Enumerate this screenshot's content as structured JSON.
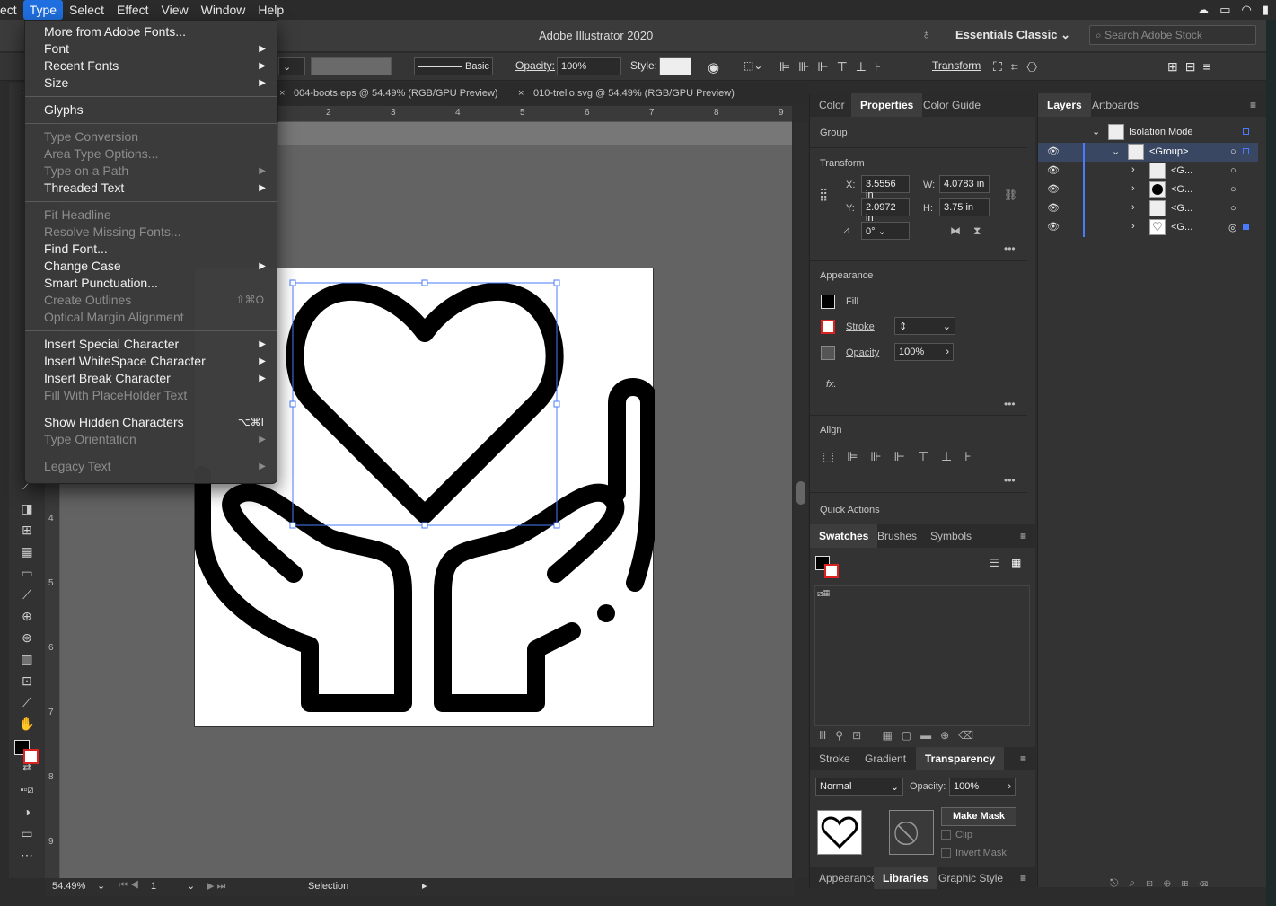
{
  "menubar": {
    "app_fragment": "ect",
    "items": [
      "Type",
      "Select",
      "Effect",
      "View",
      "Window",
      "Help"
    ]
  },
  "title": {
    "app": "Adobe Illustrator 2020",
    "workspace": "Essentials Classic",
    "search_placeholder": "Search Adobe Stock"
  },
  "control": {
    "stroke_style": "Basic",
    "opacity_label": "Opacity:",
    "opacity": "100%",
    "style_label": "Style:",
    "transform": "Transform"
  },
  "tabs": [
    "004-boots.eps @ 54.49% (RGB/GPU Preview)",
    "010-trello.svg @ 54.49% (RGB/GPU Preview)"
  ],
  "ruler_h": [
    "2",
    "3",
    "4",
    "5",
    "6",
    "7",
    "8",
    "9"
  ],
  "ruler_v": [
    "4",
    "5",
    "6",
    "7",
    "8",
    "9"
  ],
  "menu": {
    "items": [
      {
        "label": "More from Adobe Fonts...",
        "dis": false,
        "arrow": false
      },
      {
        "label": "Font",
        "dis": false,
        "arrow": true
      },
      {
        "label": "Recent Fonts",
        "dis": false,
        "arrow": true
      },
      {
        "label": "Size",
        "dis": false,
        "arrow": true
      },
      {
        "sep": true
      },
      {
        "label": "Glyphs",
        "dis": false,
        "arrow": false
      },
      {
        "sep": true
      },
      {
        "label": "Type Conversion",
        "dis": true,
        "arrow": false
      },
      {
        "label": "Area Type Options...",
        "dis": true,
        "arrow": false
      },
      {
        "label": "Type on a Path",
        "dis": true,
        "arrow": true
      },
      {
        "label": "Threaded Text",
        "dis": false,
        "arrow": true
      },
      {
        "sep": true
      },
      {
        "label": "Fit Headline",
        "dis": true,
        "arrow": false
      },
      {
        "label": "Resolve Missing Fonts...",
        "dis": true,
        "arrow": false
      },
      {
        "label": "Find Font...",
        "dis": false,
        "arrow": false
      },
      {
        "label": "Change Case",
        "dis": false,
        "arrow": true
      },
      {
        "label": "Smart Punctuation...",
        "dis": false,
        "arrow": false
      },
      {
        "label": "Create Outlines",
        "dis": true,
        "arrow": false,
        "shortcut": "⇧⌘O"
      },
      {
        "label": "Optical Margin Alignment",
        "dis": true,
        "arrow": false
      },
      {
        "sep": true
      },
      {
        "label": "Insert Special Character",
        "dis": false,
        "arrow": true
      },
      {
        "label": "Insert WhiteSpace Character",
        "dis": false,
        "arrow": true
      },
      {
        "label": "Insert Break Character",
        "dis": false,
        "arrow": true
      },
      {
        "label": "Fill With PlaceHolder Text",
        "dis": true,
        "arrow": false
      },
      {
        "sep": true
      },
      {
        "label": "Show Hidden Characters",
        "dis": false,
        "arrow": false,
        "shortcut": "⌥⌘I"
      },
      {
        "label": "Type Orientation",
        "dis": true,
        "arrow": true
      },
      {
        "sep": true
      },
      {
        "label": "Legacy Text",
        "dis": true,
        "arrow": true
      }
    ]
  },
  "properties": {
    "tabs": [
      "Color",
      "Properties",
      "Color Guide"
    ],
    "group": "Group",
    "transform": "Transform",
    "x_label": "X:",
    "x": "3.5556 in",
    "y_label": "Y:",
    "y": "2.0972 in",
    "w_label": "W:",
    "w": "4.0783 in",
    "h_label": "H:",
    "h": "3.75 in",
    "angle": "0°",
    "appearance": "Appearance",
    "fill": "Fill",
    "stroke": "Stroke",
    "opacity_label": "Opacity",
    "opacity": "100%",
    "fx": "fx.",
    "align": "Align",
    "quick_actions": "Quick Actions"
  },
  "swatches": {
    "tabs": [
      "Swatches",
      "Brushes",
      "Symbols"
    ]
  },
  "transparency": {
    "tabs": [
      "Stroke",
      "Gradient",
      "Transparency"
    ],
    "mode": "Normal",
    "opacity_label": "Opacity:",
    "opacity": "100%",
    "make_mask": "Make Mask",
    "clip": "Clip",
    "invert": "Invert Mask"
  },
  "bottom_tabs": [
    "Appearance",
    "Libraries",
    "Graphic Style"
  ],
  "layers": {
    "tabs": [
      "Layers",
      "Artboards"
    ],
    "isolation": "Isolation Mode",
    "group": "<Group>",
    "children": [
      "<G...",
      "<G...",
      "<G...",
      "<G..."
    ]
  },
  "statusbar": {
    "zoom": "54.49%",
    "page": "1",
    "tool": "Selection"
  },
  "colors": {
    "accent": "#1f6fe0",
    "layer_blue": "#4a7bff"
  }
}
